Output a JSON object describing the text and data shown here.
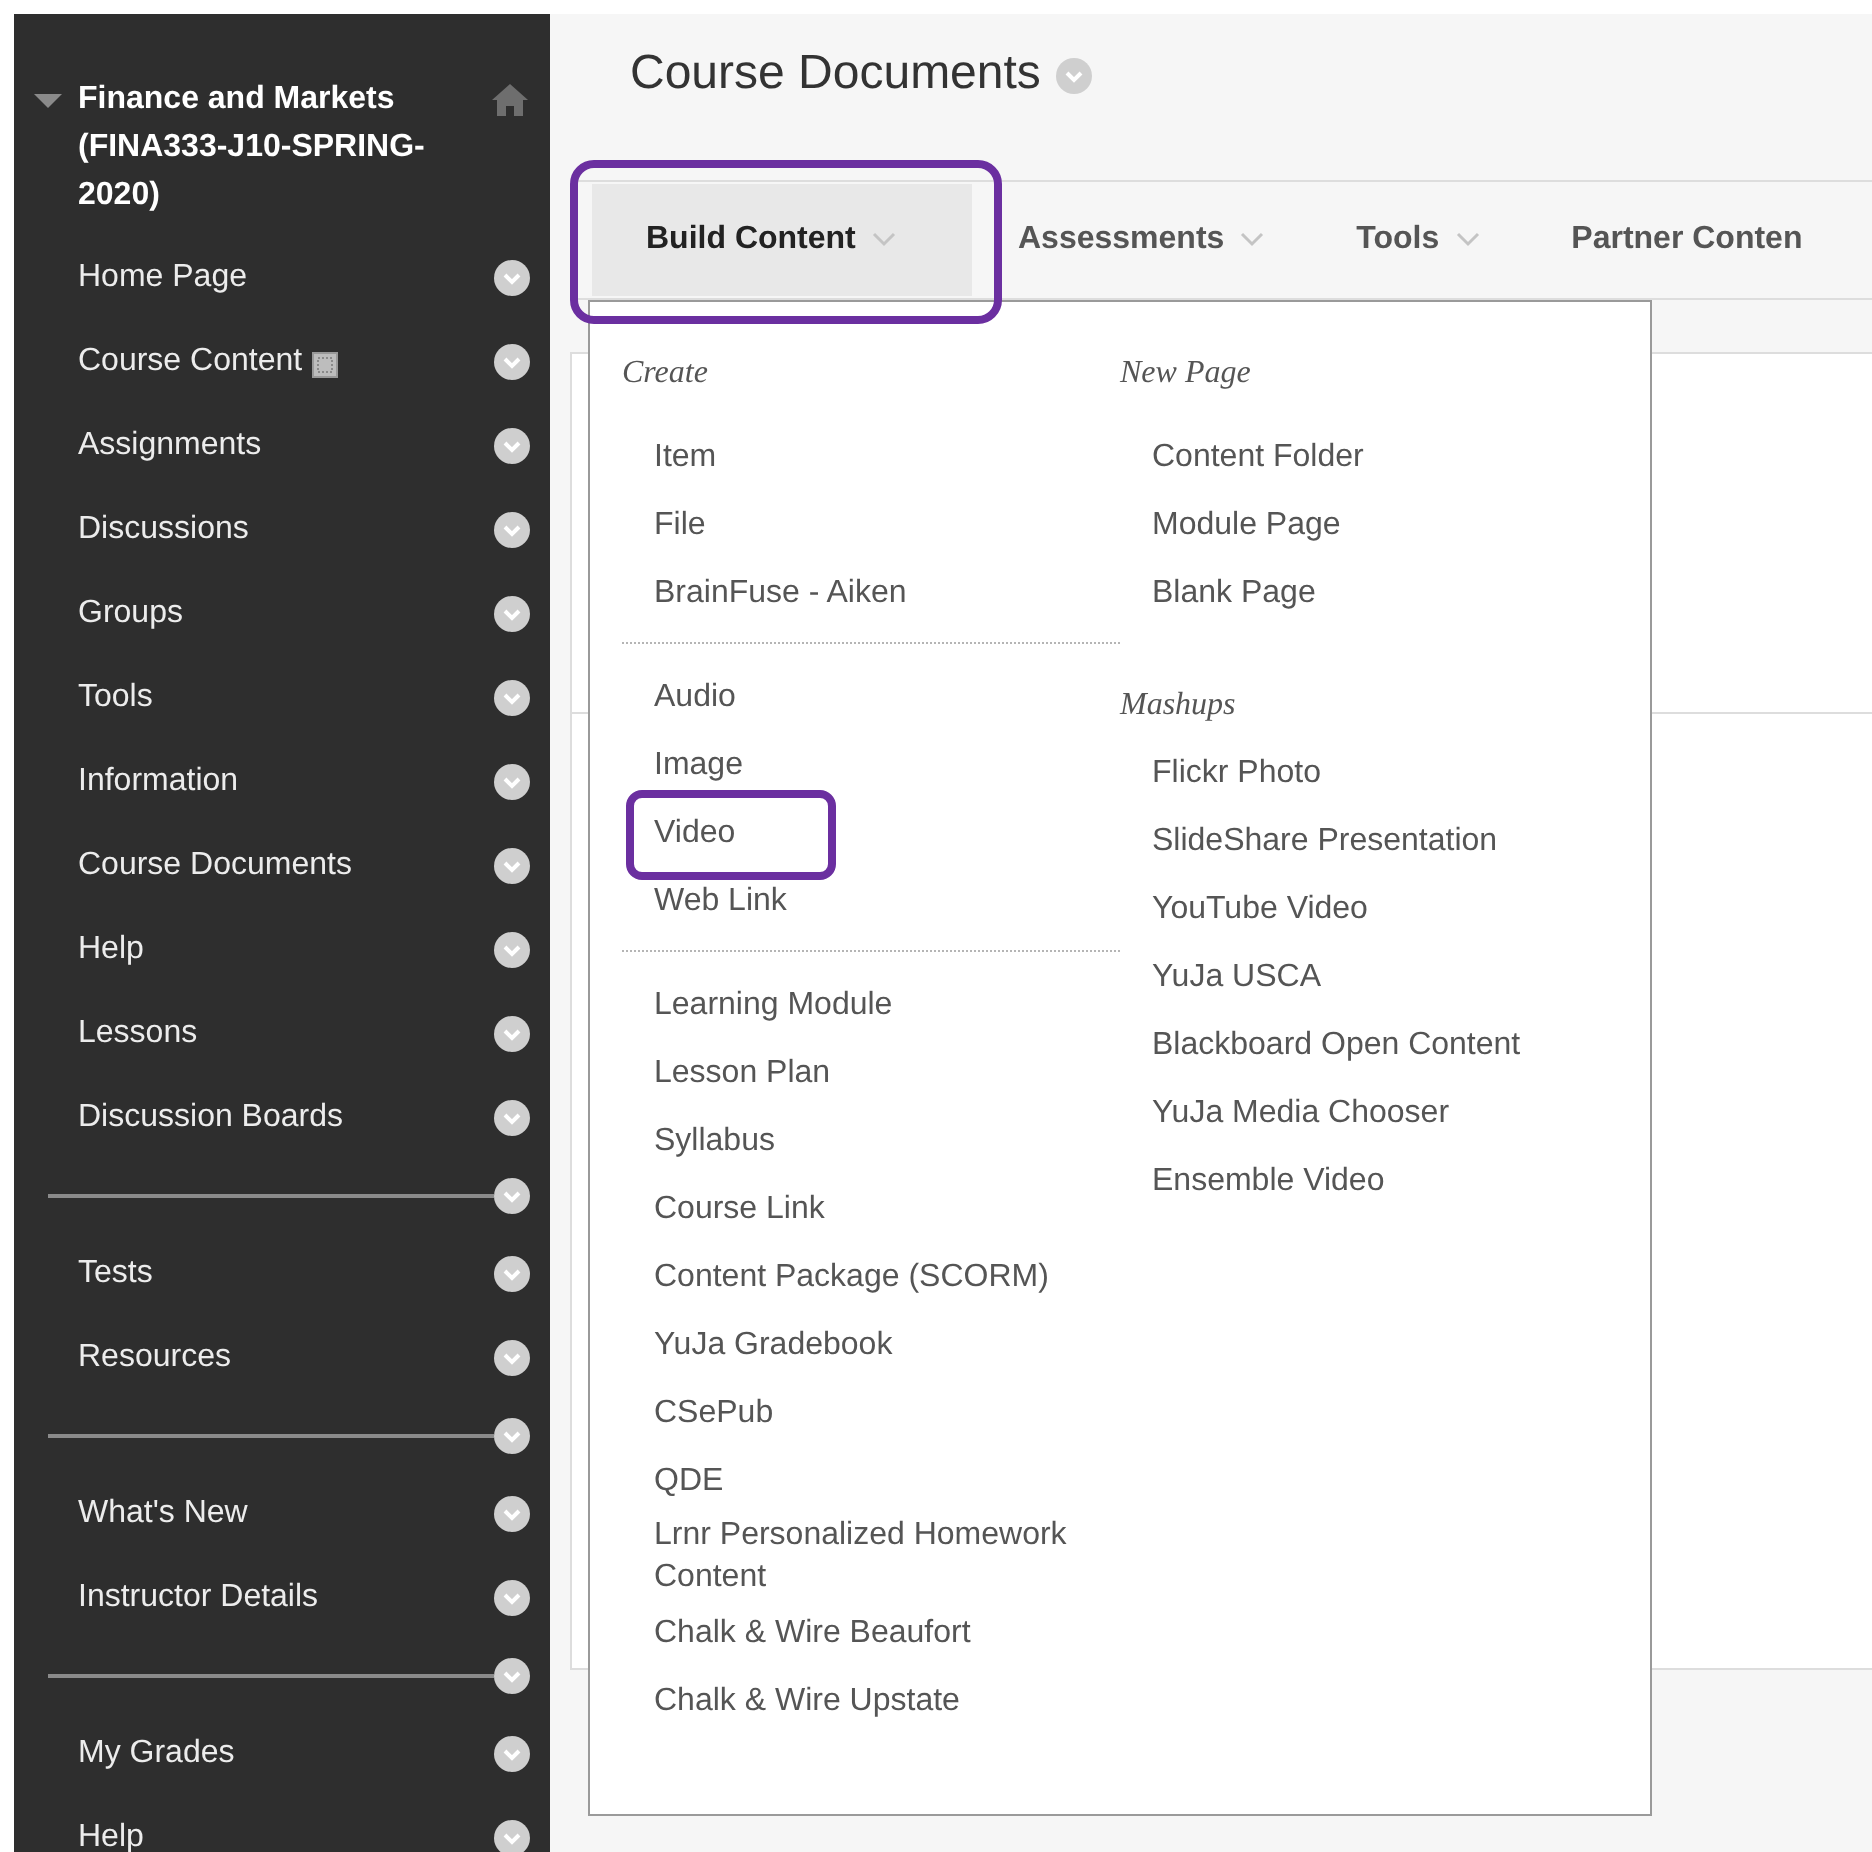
{
  "sidebar": {
    "course_title": "Finance and Markets (FINA333-J10-SPRING-2020)",
    "expanded": true,
    "items": [
      {
        "kind": "link",
        "label": "Home Page"
      },
      {
        "kind": "link_icon",
        "label": "Course Content"
      },
      {
        "kind": "link",
        "label": "Assignments"
      },
      {
        "kind": "link",
        "label": "Discussions"
      },
      {
        "kind": "link",
        "label": "Groups"
      },
      {
        "kind": "link",
        "label": "Tools"
      },
      {
        "kind": "link",
        "label": "Information"
      },
      {
        "kind": "link",
        "label": "Course Documents"
      },
      {
        "kind": "link",
        "label": "Help"
      },
      {
        "kind": "link",
        "label": "Lessons"
      },
      {
        "kind": "link",
        "label": "Discussion Boards"
      },
      {
        "kind": "divider"
      },
      {
        "kind": "link",
        "label": "Tests"
      },
      {
        "kind": "link",
        "label": "Resources"
      },
      {
        "kind": "divider"
      },
      {
        "kind": "link",
        "label": "What's New"
      },
      {
        "kind": "link",
        "label": "Instructor Details"
      },
      {
        "kind": "divider"
      },
      {
        "kind": "link",
        "label": "My Grades"
      },
      {
        "kind": "link",
        "label": "Help"
      }
    ]
  },
  "page_title": "Course Documents",
  "tabs": [
    {
      "label": "Build Content",
      "selected": true,
      "highlighted": true
    },
    {
      "label": "Assessments",
      "selected": false,
      "highlighted": false
    },
    {
      "label": "Tools",
      "selected": false,
      "highlighted": false
    },
    {
      "label": "Partner Conten",
      "selected": false,
      "highlighted": false
    }
  ],
  "menu": {
    "columns": [
      {
        "dividers": true,
        "groups": [
          {
            "heading": "Create",
            "items": [
              {
                "label": "Item",
                "highlighted": false
              },
              {
                "label": "File",
                "highlighted": false
              },
              {
                "label": "BrainFuse - Aiken",
                "highlighted": false
              }
            ]
          },
          {
            "items": [
              {
                "label": "Audio",
                "highlighted": false
              },
              {
                "label": "Image",
                "highlighted": false
              },
              {
                "label": "Video",
                "highlighted": true
              },
              {
                "label": "Web Link",
                "highlighted": false
              }
            ]
          },
          {
            "items": [
              {
                "label": "Learning Module",
                "highlighted": false
              },
              {
                "label": "Lesson Plan",
                "highlighted": false
              },
              {
                "label": "Syllabus",
                "highlighted": false
              },
              {
                "label": "Course Link",
                "highlighted": false
              },
              {
                "label": "Content Package (SCORM)",
                "highlighted": false
              },
              {
                "label": "YuJa Gradebook",
                "highlighted": false
              },
              {
                "label": "CSePub",
                "highlighted": false
              },
              {
                "label": "QDE",
                "highlighted": false
              },
              {
                "label": "Lrnr Personalized Homework Content",
                "highlighted": false
              },
              {
                "label": "Chalk & Wire Beaufort",
                "highlighted": false
              },
              {
                "label": "Chalk & Wire Upstate",
                "highlighted": false
              }
            ]
          }
        ]
      },
      {
        "dividers": false,
        "groups": [
          {
            "heading": "New Page",
            "items": [
              {
                "label": "Content Folder",
                "highlighted": false
              },
              {
                "label": "Module Page",
                "highlighted": false
              },
              {
                "label": "Blank Page",
                "highlighted": false
              }
            ]
          },
          {
            "heading": "Mashups",
            "items": [
              {
                "label": "Flickr Photo",
                "highlighted": false
              },
              {
                "label": "SlideShare Presentation",
                "highlighted": false
              },
              {
                "label": "YouTube Video",
                "highlighted": false
              },
              {
                "label": "YuJa USCA",
                "highlighted": false
              },
              {
                "label": "Blackboard Open Content",
                "highlighted": false
              },
              {
                "label": "YuJa Media Chooser",
                "highlighted": false
              },
              {
                "label": "Ensemble Video",
                "highlighted": false
              }
            ]
          }
        ]
      }
    ]
  }
}
